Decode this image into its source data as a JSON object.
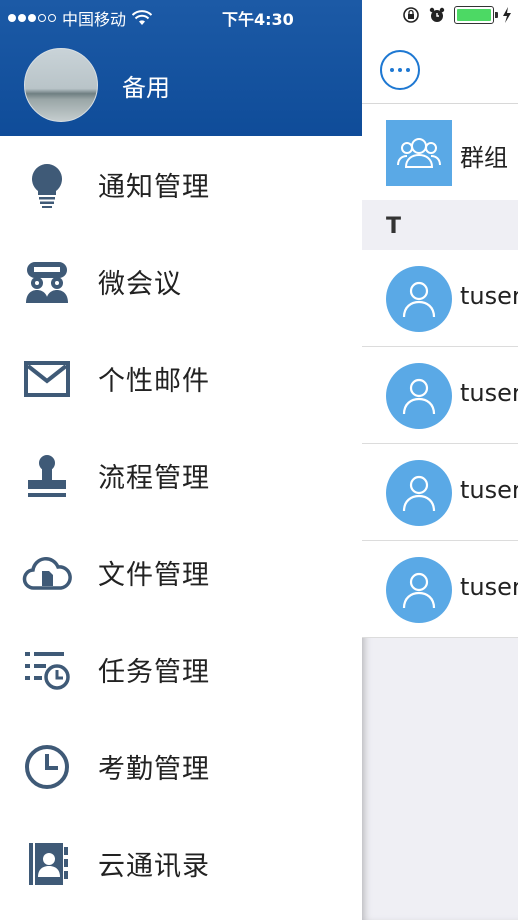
{
  "status_bar": {
    "carrier": "中国移动",
    "time": "下午4:30",
    "battery_color": "#4cd964"
  },
  "drawer": {
    "header_color": "#0f4c99",
    "user_name": "备用",
    "menu": [
      {
        "label": "通知管理",
        "icon": "lightbulb-icon"
      },
      {
        "label": "微会议",
        "icon": "meeting-icon"
      },
      {
        "label": "个性邮件",
        "icon": "mail-icon"
      },
      {
        "label": "流程管理",
        "icon": "stamp-icon"
      },
      {
        "label": "文件管理",
        "icon": "cloud-file-icon"
      },
      {
        "label": "任务管理",
        "icon": "task-list-icon"
      },
      {
        "label": "考勤管理",
        "icon": "clock-icon"
      },
      {
        "label": "云通讯录",
        "icon": "contact-book-icon"
      }
    ]
  },
  "contacts_panel": {
    "accent": "#1e78d2",
    "avatar_color": "#5aa9e6",
    "group_label": "群组",
    "section_letter": "T",
    "contacts": [
      {
        "name": "tuser"
      },
      {
        "name": "tuser"
      },
      {
        "name": "tuser"
      },
      {
        "name": "tuser"
      }
    ]
  }
}
